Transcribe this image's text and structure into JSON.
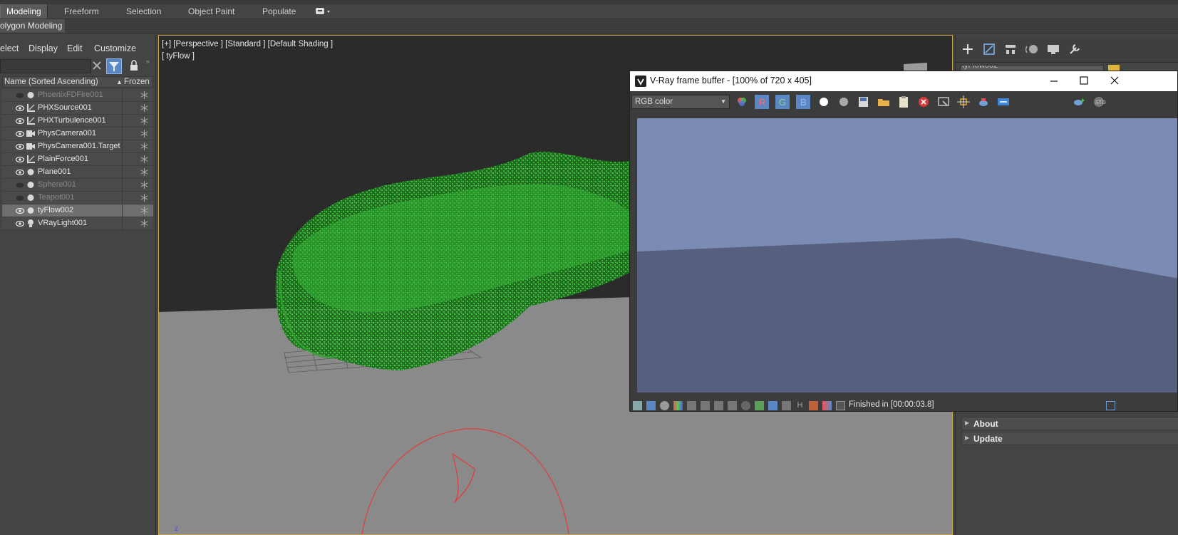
{
  "ribbon": {
    "tabs": [
      {
        "label": "Modeling",
        "active": true
      },
      {
        "label": "Freeform"
      },
      {
        "label": "Selection"
      },
      {
        "label": "Object Paint"
      },
      {
        "label": "Populate"
      }
    ],
    "sub_label": "olygon Modeling"
  },
  "explorer": {
    "menu": [
      "elect",
      "Display",
      "Edit",
      "Customize"
    ],
    "header": {
      "name_col": "Name (Sorted Ascending)",
      "sort_arrow": "▲",
      "frozen_col": "Frozen"
    },
    "rows": [
      {
        "name": "PhoenixFDFire001",
        "type": "sphere",
        "visible": false
      },
      {
        "name": "PHXSource001",
        "type": "helper",
        "visible": true
      },
      {
        "name": "PHXTurbulence001",
        "type": "helper",
        "visible": true
      },
      {
        "name": "PhysCamera001",
        "type": "camera",
        "visible": true
      },
      {
        "name": "PhysCamera001.Target",
        "type": "camera",
        "visible": true
      },
      {
        "name": "PlainForce001",
        "type": "helper",
        "visible": true
      },
      {
        "name": "Plane001",
        "type": "sphere",
        "visible": true
      },
      {
        "name": "Sphere001",
        "type": "sphere",
        "visible": false
      },
      {
        "name": "Teapot001",
        "type": "sphere",
        "visible": false
      },
      {
        "name": "tyFlow002",
        "type": "sphere",
        "visible": true,
        "selected": true
      },
      {
        "name": "VRayLight001",
        "type": "light",
        "visible": true
      }
    ]
  },
  "viewport": {
    "label": "[+] [Perspective ] [Standard ] [Default Shading ]",
    "label2": "[ tyFlow ]",
    "particle_color": "#2fa52f",
    "border_color": "#c9a646"
  },
  "vfb": {
    "title": "V-Ray frame buffer - [100% of 720 x 405]",
    "channel": "RGB color",
    "status": "Finished in [00:00:03.8]",
    "render_sky": "#7a8cb4",
    "render_ground": "#56607e"
  },
  "command_panel": {
    "object_name": "tyFlow002",
    "rollouts": [
      {
        "label": "About"
      },
      {
        "label": "Update"
      }
    ]
  }
}
